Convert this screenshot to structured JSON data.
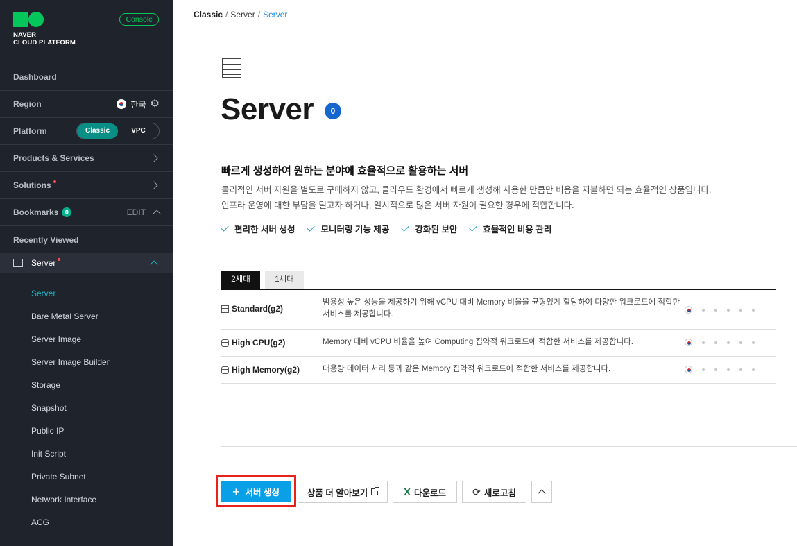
{
  "sidebar": {
    "logo_line1": "NAVER",
    "logo_line2": "CLOUD PLATFORM",
    "console_label": "Console",
    "dashboard": "Dashboard",
    "region_label": "Region",
    "region_value": "한국",
    "platform_label": "Platform",
    "platform_options": [
      "Classic",
      "VPC"
    ],
    "platform_selected": "Classic",
    "products_label": "Products & Services",
    "solutions_label": "Solutions",
    "bookmarks_label": "Bookmarks",
    "bookmarks_count": "0",
    "edit_label": "EDIT",
    "recently_viewed": "Recently Viewed",
    "server_group": "Server",
    "items": [
      {
        "label": "Server",
        "active": true
      },
      {
        "label": "Bare Metal Server"
      },
      {
        "label": "Server Image"
      },
      {
        "label": "Server Image Builder"
      },
      {
        "label": "Storage"
      },
      {
        "label": "Snapshot"
      },
      {
        "label": "Public IP"
      },
      {
        "label": "Init Script"
      },
      {
        "label": "Private Subnet"
      },
      {
        "label": "Network Interface"
      },
      {
        "label": "ACG"
      }
    ]
  },
  "breadcrumb": {
    "root": "Classic",
    "parent": "Server",
    "current": "Server"
  },
  "page": {
    "title": "Server",
    "count": "0",
    "headline": "빠르게 생성하여 원하는 분야에 효율적으로 활용하는 서버",
    "desc_line1": "물리적인 서버 자원을 별도로 구매하지 않고, 클라우드 환경에서 빠르게 생성해 사용한 만큼만 비용을 지불하면 되는 효율적인 상품입니다.",
    "desc_line2": "인프라 운영에 대한 부담을 덜고자 하거나, 일시적으로 많은 서버 자원이 필요한 경우에 적합합니다.",
    "features": [
      "편리한 서버 생성",
      "모니터링 기능 제공",
      "강화된 보안",
      "효율적인 비용 관리"
    ],
    "tabs": [
      "2세대",
      "1세대"
    ],
    "active_tab": "2세대",
    "products": [
      {
        "icon": "server-icon",
        "name": "Standard(g2)",
        "desc": "범용성 높은 성능을 제공하기 위해 vCPU 대비 Memory 비율을 균형있게 할당하여 다양한 워크로드에 적합한 서비스를 제공합니다."
      },
      {
        "icon": "cpu-icon",
        "name": "High CPU(g2)",
        "desc": "Memory 대비 vCPU 비율을 높여 Computing 집약적 워크로드에 적합한 서비스를 제공합니다."
      },
      {
        "icon": "memory-icon",
        "name": "High Memory(g2)",
        "desc": "대용량 데이터 처리 등과 같은 Memory 집약적 워크로드에 적합한 서비스를 제공합니다."
      }
    ]
  },
  "actions": {
    "create": "서버 생성",
    "learn_more": "상품 더 알아보기",
    "download": "다운로드",
    "refresh": "새로고침"
  },
  "colors": {
    "sidebar_bg": "#1f232b",
    "accent_green": "#03c75a",
    "active_teal": "#14b4c4",
    "primary_button": "#0aa0e8",
    "highlight": "#e8211b"
  }
}
